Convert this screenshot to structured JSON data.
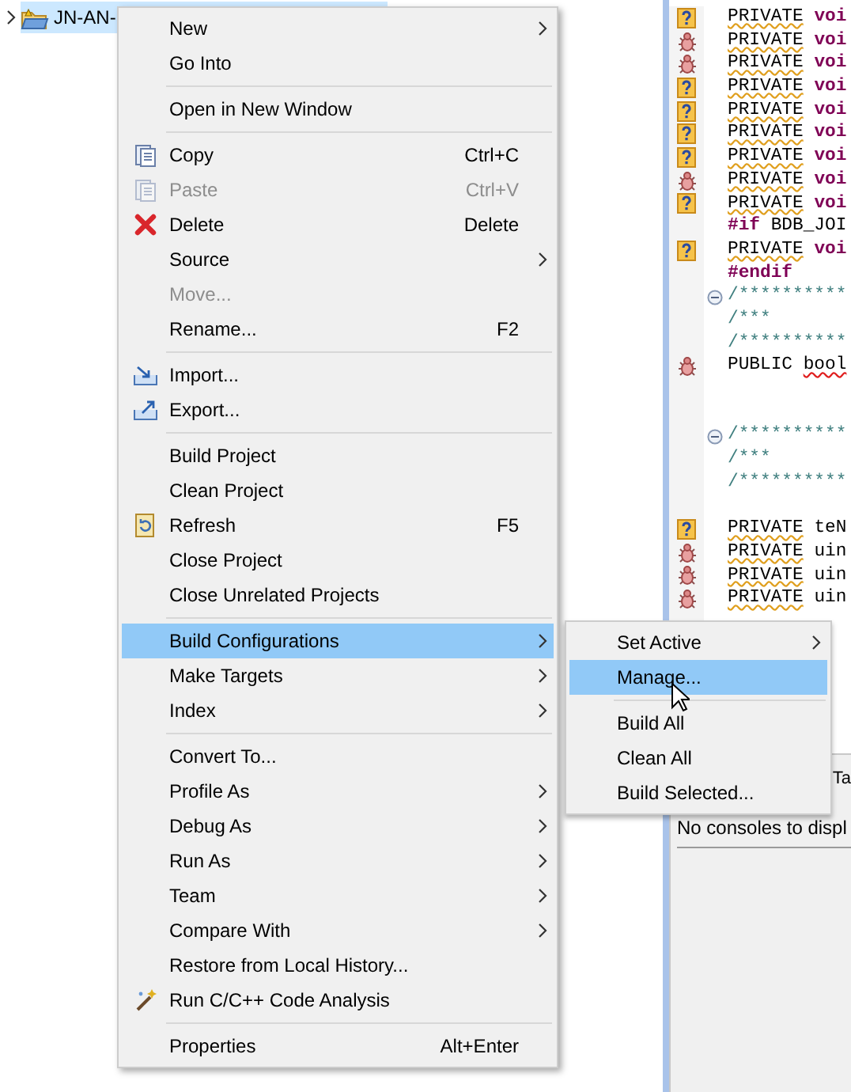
{
  "tree": {
    "item": {
      "label": "JN-AN-",
      "selected": true
    }
  },
  "context_menu": {
    "items": [
      {
        "kind": "item",
        "label": "New",
        "submenu": true,
        "disabled": false,
        "selected": false
      },
      {
        "kind": "item",
        "label": "Go Into",
        "submenu": false,
        "disabled": false,
        "selected": false
      },
      {
        "kind": "separator"
      },
      {
        "kind": "item",
        "label": "Open in New Window",
        "submenu": false,
        "disabled": false,
        "selected": false
      },
      {
        "kind": "separator"
      },
      {
        "kind": "item",
        "label": "Copy",
        "shortcut": "Ctrl+C",
        "submenu": false,
        "disabled": false,
        "selected": false
      },
      {
        "kind": "item",
        "label": "Paste",
        "shortcut": "Ctrl+V",
        "submenu": false,
        "disabled": true,
        "selected": false
      },
      {
        "kind": "item",
        "label": "Delete",
        "shortcut": "Delete",
        "submenu": false,
        "disabled": false,
        "selected": false
      },
      {
        "kind": "item",
        "label": "Source",
        "submenu": true,
        "disabled": false,
        "selected": false
      },
      {
        "kind": "item",
        "label": "Move...",
        "submenu": false,
        "disabled": true,
        "selected": false
      },
      {
        "kind": "item",
        "label": "Rename...",
        "shortcut": "F2",
        "submenu": false,
        "disabled": false,
        "selected": false
      },
      {
        "kind": "separator"
      },
      {
        "kind": "item",
        "label": "Import...",
        "submenu": false,
        "disabled": false,
        "selected": false
      },
      {
        "kind": "item",
        "label": "Export...",
        "submenu": false,
        "disabled": false,
        "selected": false
      },
      {
        "kind": "separator"
      },
      {
        "kind": "item",
        "label": "Build Project",
        "submenu": false,
        "disabled": false,
        "selected": false
      },
      {
        "kind": "item",
        "label": "Clean Project",
        "submenu": false,
        "disabled": false,
        "selected": false
      },
      {
        "kind": "item",
        "label": "Refresh",
        "shortcut": "F5",
        "submenu": false,
        "disabled": false,
        "selected": false
      },
      {
        "kind": "item",
        "label": "Close Project",
        "submenu": false,
        "disabled": false,
        "selected": false
      },
      {
        "kind": "item",
        "label": "Close Unrelated Projects",
        "submenu": false,
        "disabled": false,
        "selected": false
      },
      {
        "kind": "separator"
      },
      {
        "kind": "item",
        "label": "Build Configurations",
        "submenu": true,
        "disabled": false,
        "selected": true
      },
      {
        "kind": "item",
        "label": "Make Targets",
        "submenu": true,
        "disabled": false,
        "selected": false
      },
      {
        "kind": "item",
        "label": "Index",
        "submenu": true,
        "disabled": false,
        "selected": false
      },
      {
        "kind": "separator"
      },
      {
        "kind": "item",
        "label": "Convert To...",
        "submenu": false,
        "disabled": false,
        "selected": false
      },
      {
        "kind": "item",
        "label": "Profile As",
        "submenu": true,
        "disabled": false,
        "selected": false
      },
      {
        "kind": "item",
        "label": "Debug As",
        "submenu": true,
        "disabled": false,
        "selected": false
      },
      {
        "kind": "item",
        "label": "Run As",
        "submenu": true,
        "disabled": false,
        "selected": false
      },
      {
        "kind": "item",
        "label": "Team",
        "submenu": true,
        "disabled": false,
        "selected": false
      },
      {
        "kind": "item",
        "label": "Compare With",
        "submenu": true,
        "disabled": false,
        "selected": false
      },
      {
        "kind": "item",
        "label": "Restore from Local History...",
        "submenu": false,
        "disabled": false,
        "selected": false
      },
      {
        "kind": "item",
        "label": "Run C/C++ Code Analysis",
        "submenu": false,
        "disabled": false,
        "selected": false
      },
      {
        "kind": "separator"
      },
      {
        "kind": "item",
        "label": "Properties",
        "shortcut": "Alt+Enter",
        "submenu": false,
        "disabled": false,
        "selected": false
      }
    ]
  },
  "submenu": {
    "items": [
      {
        "kind": "item",
        "label": "Set Active",
        "submenu": true,
        "selected": false
      },
      {
        "kind": "item",
        "label": "Manage...",
        "submenu": false,
        "selected": true
      },
      {
        "kind": "separator"
      },
      {
        "kind": "item",
        "label": "Build All",
        "submenu": false,
        "selected": false
      },
      {
        "kind": "item",
        "label": "Clean All",
        "submenu": false,
        "selected": false
      },
      {
        "kind": "item",
        "label": "Build Selected...",
        "submenu": false,
        "selected": false
      }
    ]
  },
  "editor": {
    "lines": [
      {
        "kind": "warning",
        "fold": false,
        "parts": [
          {
            "text": "PRIVATE",
            "kind": "macro"
          },
          {
            "text": "voi",
            "kind": "keyword"
          }
        ]
      },
      {
        "kind": "error",
        "fold": false,
        "parts": [
          {
            "text": "PRIVATE",
            "kind": "macro"
          },
          {
            "text": "voi",
            "kind": "keyword"
          }
        ]
      },
      {
        "kind": "error",
        "fold": false,
        "parts": [
          {
            "text": "PRIVATE",
            "kind": "macro"
          },
          {
            "text": "voi",
            "kind": "keyword"
          }
        ]
      },
      {
        "kind": "warning",
        "fold": false,
        "parts": [
          {
            "text": "PRIVATE",
            "kind": "macro"
          },
          {
            "text": "voi",
            "kind": "keyword"
          }
        ]
      },
      {
        "kind": "warning",
        "fold": false,
        "parts": [
          {
            "text": "PRIVATE",
            "kind": "macro"
          },
          {
            "text": "voi",
            "kind": "keyword"
          }
        ]
      },
      {
        "kind": "warning",
        "fold": false,
        "parts": [
          {
            "text": "PRIVATE",
            "kind": "macro"
          },
          {
            "text": "voi",
            "kind": "keyword"
          }
        ]
      },
      {
        "kind": "warning",
        "fold": false,
        "parts": [
          {
            "text": "PRIVATE",
            "kind": "macro"
          },
          {
            "text": "voi",
            "kind": "keyword"
          }
        ]
      },
      {
        "kind": "error",
        "fold": false,
        "parts": [
          {
            "text": "PRIVATE",
            "kind": "macro"
          },
          {
            "text": "voi",
            "kind": "keyword"
          }
        ]
      },
      {
        "kind": "warning",
        "fold": false,
        "parts": [
          {
            "text": "PRIVATE",
            "kind": "macro"
          },
          {
            "text": "voi",
            "kind": "keyword"
          }
        ]
      },
      {
        "kind": "none",
        "fold": false,
        "parts": [
          {
            "text": "#if",
            "kind": "keyword"
          },
          {
            "text": "BDB_JOI",
            "kind": "plain"
          }
        ]
      },
      {
        "kind": "warning",
        "fold": false,
        "parts": [
          {
            "text": "PRIVATE",
            "kind": "macro"
          },
          {
            "text": "voi",
            "kind": "keyword"
          }
        ]
      },
      {
        "kind": "none",
        "fold": false,
        "parts": [
          {
            "text": "#endif",
            "kind": "keyword"
          }
        ]
      },
      {
        "kind": "none",
        "fold": true,
        "parts": [
          {
            "text": "/**********",
            "kind": "comment"
          }
        ]
      },
      {
        "kind": "none",
        "fold": false,
        "parts": [
          {
            "text": "/***",
            "kind": "comment"
          }
        ]
      },
      {
        "kind": "none",
        "fold": false,
        "parts": [
          {
            "text": "/**********",
            "kind": "comment"
          }
        ]
      },
      {
        "kind": "error",
        "fold": false,
        "parts": [
          {
            "text": "PUBLIC",
            "kind": "plain"
          },
          {
            "text": "bool",
            "kind": "error"
          }
        ]
      },
      {
        "kind": "none",
        "fold": false
      },
      {
        "kind": "none",
        "fold": false
      },
      {
        "kind": "none",
        "fold": true,
        "parts": [
          {
            "text": "/**********",
            "kind": "comment"
          }
        ]
      },
      {
        "kind": "none",
        "fold": false,
        "parts": [
          {
            "text": "/***",
            "kind": "comment"
          }
        ]
      },
      {
        "kind": "none",
        "fold": false,
        "parts": [
          {
            "text": "/**********",
            "kind": "comment"
          }
        ]
      },
      {
        "kind": "none",
        "fold": false
      },
      {
        "kind": "warning",
        "fold": false,
        "parts": [
          {
            "text": "PRIVATE",
            "kind": "macro"
          },
          {
            "text": "teN",
            "kind": "plain"
          }
        ]
      },
      {
        "kind": "error",
        "fold": false,
        "parts": [
          {
            "text": "PRIVATE",
            "kind": "macro"
          },
          {
            "text": "uin",
            "kind": "plain"
          }
        ]
      },
      {
        "kind": "error",
        "fold": false,
        "parts": [
          {
            "text": "PRIVATE",
            "kind": "macro"
          },
          {
            "text": "uin",
            "kind": "plain"
          }
        ]
      },
      {
        "kind": "error",
        "fold": false,
        "parts": [
          {
            "text": "PRIVATE",
            "kind": "macro"
          },
          {
            "text": "uin",
            "kind": "plain"
          }
        ]
      }
    ]
  },
  "console": {
    "tab": "Ta",
    "message": "No consoles to displ"
  }
}
